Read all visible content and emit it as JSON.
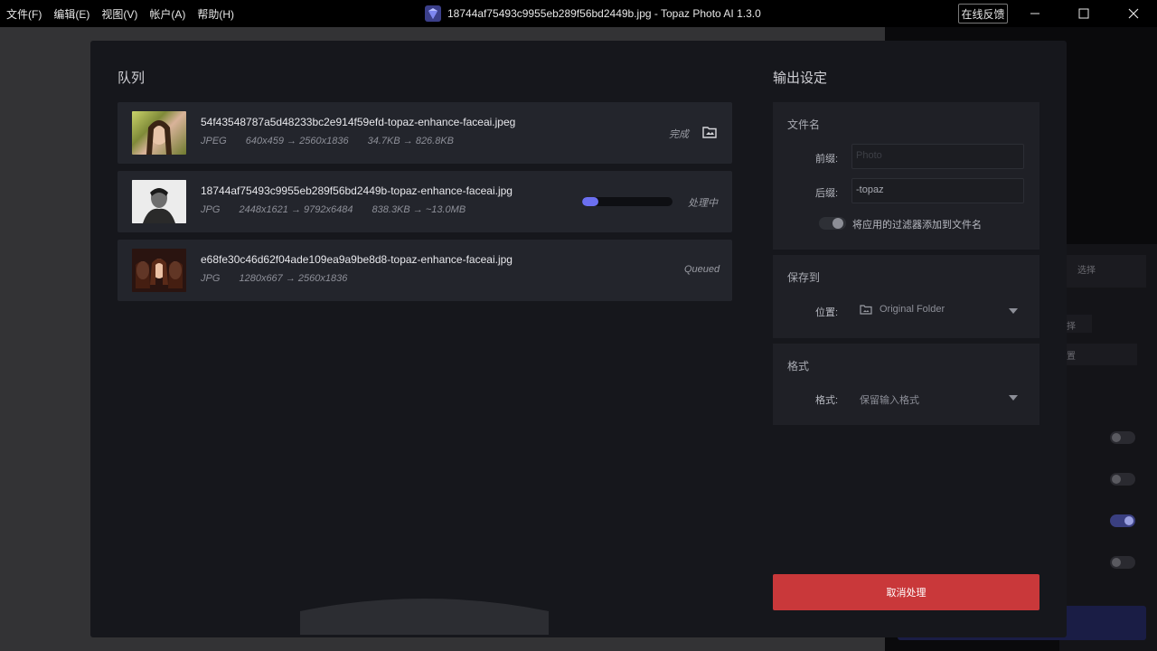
{
  "titlebar": {
    "menus": [
      "文件(F)",
      "编辑(E)",
      "视图(V)",
      "帐户(A)",
      "帮助(H)"
    ],
    "title": "18744af75493c9955eb289f56bd2449b.jpg - Topaz Photo AI 1.3.0",
    "feedback": "在线反馈"
  },
  "background": {
    "select_label": "选择",
    "chip_1": "择",
    "chip_2": "置"
  },
  "queue": {
    "title": "队列",
    "items": [
      {
        "filename": "54f43548787a5d48233bc2e914f59efd-topaz-enhance-faceai.jpeg",
        "format": "JPEG",
        "dims": "640x459 → 2560x1836",
        "size": "34.7KB → 826.8KB",
        "status": "完成"
      },
      {
        "filename": "18744af75493c9955eb289f56bd2449b-topaz-enhance-faceai.jpg",
        "format": "JPG",
        "dims": "2448x1621 → 9792x6484",
        "size": "838.3KB → ~13.0MB",
        "status": "处理中",
        "progress": 0.18
      },
      {
        "filename": "e68fe30c46d62f04ade109ea9a9be8d8-topaz-enhance-faceai.jpg",
        "format": "JPG",
        "dims": "1280x667 → 2560x1836",
        "status": "Queued"
      }
    ]
  },
  "output": {
    "title": "输出设定",
    "filename_section": {
      "title": "文件名",
      "prefix_label": "前缀:",
      "prefix_placeholder": "Photo",
      "suffix_label": "后缀:",
      "suffix_value": "-topaz",
      "toggle_label": "将应用的过滤器添加到文件名"
    },
    "save_section": {
      "title": "保存到",
      "location_label": "位置:",
      "location_value": "Original Folder"
    },
    "format_section": {
      "title": "格式",
      "format_label": "格式:",
      "format_value": "保留输入格式"
    },
    "cancel_button": "取消处理"
  },
  "colors": {
    "accent": "#6b6ff0",
    "cancel": "#c9383a"
  }
}
